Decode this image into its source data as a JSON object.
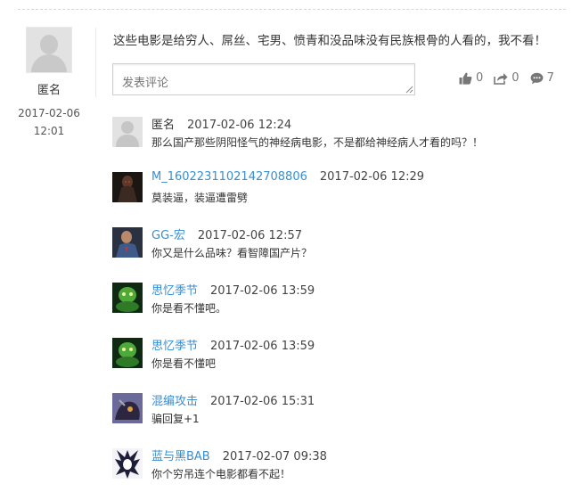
{
  "main_comment": {
    "author": "匿名",
    "time": "2017-02-06 12:01",
    "text": "这些电影是给穷人、屌丝、宅男、愤青和没品味没有民族根骨的人看的，我不看！",
    "reply_placeholder": "发表评论",
    "likes": "0",
    "shares": "0",
    "comments": "7"
  },
  "replies": [
    {
      "name": "匿名",
      "time": "2017-02-06 12:24",
      "text": "那么国产那些阴阳怪气的神经病电影，不是都给神经病人才看的吗？！",
      "avatar": "default-avatar"
    },
    {
      "name": "M_1602231102142708806",
      "time": "2017-02-06 12:29",
      "text": "莫装逼，装逼遭雷劈",
      "avatar": "dark-figure-avatar"
    },
    {
      "name": "GG-宏",
      "time": "2017-02-06 12:57",
      "text": "你又是什么品味？看智障国产片？",
      "avatar": "hero-avatar"
    },
    {
      "name": "思忆季节",
      "time": "2017-02-06 13:59",
      "text": "你是看不懂吧。",
      "avatar": "green-creature-avatar"
    },
    {
      "name": "思忆季节",
      "time": "2017-02-06 13:59",
      "text": "你是看不懂吧",
      "avatar": "green-creature-avatar"
    },
    {
      "name": "混编攻击",
      "time": "2017-02-06 15:31",
      "text": "骗回复+1",
      "avatar": "purple-creature-avatar"
    },
    {
      "name": "蓝与黑BAB",
      "time": "2017-02-07 09:38",
      "text": "你个穷吊连个电影都看不起！",
      "avatar": "anime-avatar"
    }
  ],
  "colors": {
    "link": "#3a8ed0",
    "text": "#333333",
    "border": "#cfcfcf",
    "icon": "#777777"
  }
}
